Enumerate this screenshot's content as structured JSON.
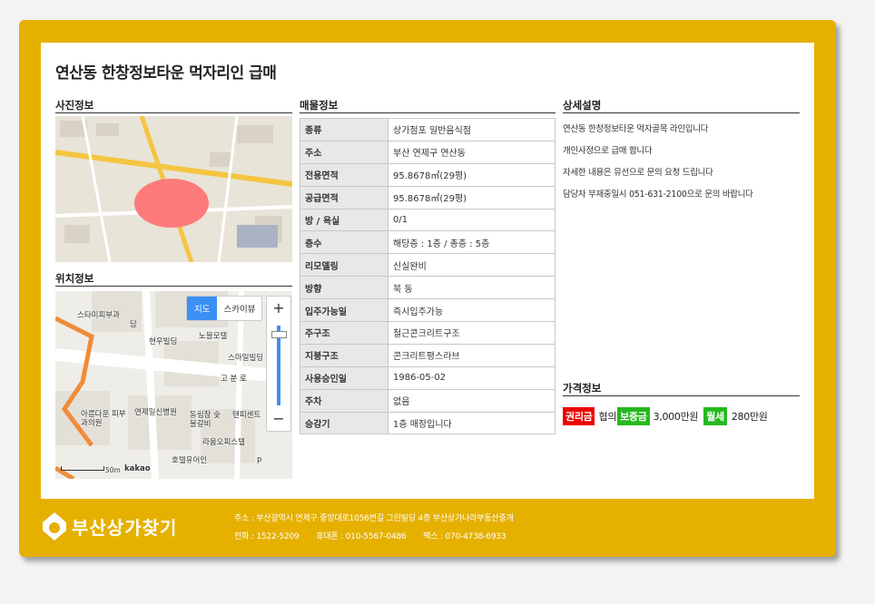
{
  "title": "연산동 한창정보타운 먹자리인 급매",
  "sections": {
    "photo": "사진정보",
    "location": "위치정보",
    "property": "매물정보",
    "detail": "상세설명",
    "price": "가격정보"
  },
  "property_rows": [
    {
      "k": "종류",
      "v": "상가점포 일반음식점"
    },
    {
      "k": "주소",
      "v": "부산 연제구 연산동"
    },
    {
      "k": "전용면적",
      "v": "95.8678㎡(29평)"
    },
    {
      "k": "공급면적",
      "v": "95.8678㎡(29평)"
    },
    {
      "k": "방 / 욕실",
      "v": "0/1"
    },
    {
      "k": "층수",
      "v": "해당층 : 1층 / 총층 : 5층"
    },
    {
      "k": "리모델링",
      "v": "신실완비"
    },
    {
      "k": "방향",
      "v": "북 동"
    },
    {
      "k": "입주가능일",
      "v": "즉시입주가능"
    },
    {
      "k": "주구조",
      "v": "철근콘크리트구조"
    },
    {
      "k": "지붕구조",
      "v": "콘크리트평스라브"
    },
    {
      "k": "사용승인일",
      "v": "1986-05-02"
    },
    {
      "k": "주차",
      "v": "없음"
    },
    {
      "k": "승강기",
      "v": "1층 매장입니다"
    }
  ],
  "description": [
    "연산동 한창정보타운 먹자골목 라인입니다",
    "개인사정으로 급매 합니다",
    "자세한 내용은 뮤선으로 문의 요청 드립니다",
    "담당자 부재중일시 051-631-2100으로 문의 바랍니다"
  ],
  "price": {
    "premium_label": "권리금",
    "premium_value": "협의",
    "deposit_label": "보증금",
    "deposit_value": "3,000만원",
    "monthly_label": "월세",
    "monthly_value": "280만원"
  },
  "map": {
    "btn_map": "지도",
    "btn_sky": "스카이뷰",
    "zoom_in": "+",
    "zoom_out": "−",
    "scale": "50m",
    "brand": "kakao",
    "labels": [
      "스타미피부과",
      "담",
      "현우빌딩",
      "노블모텔",
      "스마일빌딩",
      "고 분 로",
      "아름다운 피부과의원",
      "연제일신병원",
      "동림참 숯불갈비",
      "텐피센트",
      "라움오피스텔",
      "호텔유어인",
      "p"
    ]
  },
  "footer": {
    "logo": "부산상가찾기",
    "address": "주소 : 부산광역시 연제구 중앙대로1056번길 그린빌딩 4층 부산상가나라부동산중개",
    "phone": "전화 : 1522-5209",
    "mobile": "휴대폰 : 010-5567-0486",
    "fax": "팩스 : 070-4738-6933"
  },
  "colors": {
    "frame": "#e5b000",
    "red_tag": "#ee0000",
    "green_tag": "#25b81e",
    "map_btn": "#3b8ff5"
  }
}
